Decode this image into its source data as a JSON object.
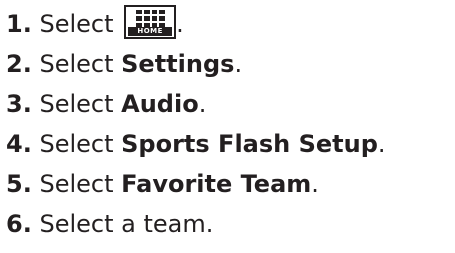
{
  "steps": [
    {
      "number": "1.",
      "text": "Select ",
      "icon": "home-icon",
      "icon_label": "HOME",
      "suffix": "."
    },
    {
      "number": "2.",
      "text": "Select ",
      "bold": "Settings",
      "suffix": "."
    },
    {
      "number": "3.",
      "text": "Select ",
      "bold": "Audio",
      "suffix": "."
    },
    {
      "number": "4.",
      "text": "Select ",
      "bold": "Sports Flash Setup",
      "suffix": "."
    },
    {
      "number": "5.",
      "text": "Select ",
      "bold": "Favorite Team",
      "suffix": "."
    },
    {
      "number": "6.",
      "text": "Select a team."
    }
  ]
}
